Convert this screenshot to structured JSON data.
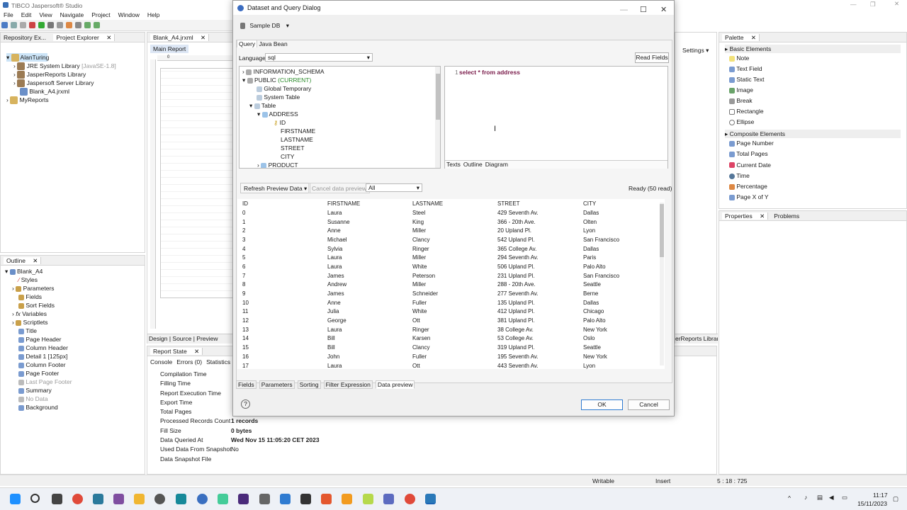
{
  "app": {
    "title": "TIBCO Jaspersoft® Studio",
    "menu": [
      "File",
      "Edit",
      "View",
      "Navigate",
      "Project",
      "Window",
      "Help"
    ]
  },
  "left": {
    "tabs": [
      "Repository Ex...",
      "Project Explorer"
    ],
    "tree": [
      {
        "label": "AlanTuring",
        "note": ""
      },
      {
        "label": "JRE System Library",
        "note": "[JavaSE-1.8]"
      },
      {
        "label": "JasperReports Library",
        "note": ""
      },
      {
        "label": "Jaspersoft Server Library",
        "note": ""
      },
      {
        "label": "Blank_A4.jrxml",
        "note": ""
      },
      {
        "label": "MyReports",
        "note": ""
      }
    ]
  },
  "editor": {
    "tab": "Blank_A4.jrxml",
    "subtab": "Main Report",
    "bottom_tabs": [
      "Design",
      "Source",
      "Preview"
    ],
    "ruler": "0"
  },
  "outline": {
    "tab": "Outline",
    "items": [
      "Blank_A4",
      "Styles",
      "Parameters",
      "Fields",
      "Sort Fields",
      "Variables",
      "Scriptlets",
      "Title",
      "Page Header",
      "Column Header",
      "Detail 1 [125px]",
      "Column Footer",
      "Page Footer",
      "Last Page Footer",
      "Summary",
      "No Data",
      "Background"
    ]
  },
  "report_state": {
    "tab": "Report State",
    "subtabs": [
      "Console",
      "Errors (0)",
      "Statistics"
    ],
    "rows": [
      {
        "label": "Compilation Time",
        "value": ""
      },
      {
        "label": "Filling Time",
        "value": ""
      },
      {
        "label": "Report Execution Time",
        "value": ""
      },
      {
        "label": "Export Time",
        "value": ""
      },
      {
        "label": "Total Pages",
        "value": ""
      },
      {
        "label": "Processed Records Count",
        "value": "1 records"
      },
      {
        "label": "Fill Size",
        "value": "0 bytes"
      },
      {
        "label": "Data Queried At",
        "value": "Wed Nov 15 11:05:20 CET 2023"
      },
      {
        "label": "Used Data From Snapshot",
        "value": "No"
      },
      {
        "label": "Data Snapshot File",
        "value": ""
      }
    ]
  },
  "palette": {
    "tab": "Palette",
    "basic_header": "Basic Elements",
    "basic": [
      "Note",
      "Text Field",
      "Static Text",
      "Image",
      "Break",
      "Rectangle",
      "Ellipse"
    ],
    "composite_header": "Composite Elements",
    "composite": [
      "Page Number",
      "Total Pages",
      "Current Date",
      "Time",
      "Percentage",
      "Page X of Y"
    ],
    "settings": "Settings",
    "lib": "erReports Library"
  },
  "props": {
    "tabs": [
      "Properties",
      "Problems"
    ]
  },
  "dialog": {
    "title": "Dataset and Query Dialog",
    "datasource": "Sample DB",
    "tabs": [
      "Query",
      "Java Bean"
    ],
    "language_label": "Language",
    "language": "sql",
    "read_fields": "Read Fields",
    "schema_tree": [
      {
        "label": "INFORMATION_SCHEMA",
        "indent": 0
      },
      {
        "label": "PUBLIC",
        "extra": "(CURRENT)",
        "indent": 0
      },
      {
        "label": "Global Temporary",
        "indent": 1
      },
      {
        "label": "System Table",
        "indent": 1
      },
      {
        "label": "Table",
        "indent": 1
      },
      {
        "label": "ADDRESS",
        "indent": 2
      },
      {
        "label": "ID",
        "indent": 3
      },
      {
        "label": "FIRSTNAME",
        "indent": 3
      },
      {
        "label": "LASTNAME",
        "indent": 3
      },
      {
        "label": "STREET",
        "indent": 3
      },
      {
        "label": "CITY",
        "indent": 3
      },
      {
        "label": "PRODUCT",
        "indent": 2
      }
    ],
    "query_line": "1",
    "query_text": "select * from address",
    "query_tabs": [
      "Texts",
      "Outline",
      "Diagram"
    ],
    "refresh": "Refresh Preview Data",
    "cancel_data": "Cancel data preview",
    "filter": "All",
    "ready": "Ready (50 read)",
    "columns": [
      "ID",
      "FIRSTNAME",
      "LASTNAME",
      "STREET",
      "CITY"
    ],
    "rows": [
      [
        "0",
        "Laura",
        "Steel",
        "429 Seventh Av.",
        "Dallas"
      ],
      [
        "1",
        "Susanne",
        "King",
        "366 - 20th Ave.",
        "Olten"
      ],
      [
        "2",
        "Anne",
        "Miller",
        "20 Upland Pl.",
        "Lyon"
      ],
      [
        "3",
        "Michael",
        "Clancy",
        "542 Upland Pl.",
        "San Francisco"
      ],
      [
        "4",
        "Sylvia",
        "Ringer",
        "365 College Av.",
        "Dallas"
      ],
      [
        "5",
        "Laura",
        "Miller",
        "294 Seventh Av.",
        "Paris"
      ],
      [
        "6",
        "Laura",
        "White",
        "506 Upland Pl.",
        "Palo Alto"
      ],
      [
        "7",
        "James",
        "Peterson",
        "231 Upland Pl.",
        "San Francisco"
      ],
      [
        "8",
        "Andrew",
        "Miller",
        "288 - 20th Ave.",
        "Seattle"
      ],
      [
        "9",
        "James",
        "Schneider",
        "277 Seventh Av.",
        "Berne"
      ],
      [
        "10",
        "Anne",
        "Fuller",
        "135 Upland Pl.",
        "Dallas"
      ],
      [
        "11",
        "Julia",
        "White",
        "412 Upland Pl.",
        "Chicago"
      ],
      [
        "12",
        "George",
        "Ott",
        "381 Upland Pl.",
        "Palo Alto"
      ],
      [
        "13",
        "Laura",
        "Ringer",
        "38 College Av.",
        "New York"
      ],
      [
        "14",
        "Bill",
        "Karsen",
        "53 College Av.",
        "Oslo"
      ],
      [
        "15",
        "Bill",
        "Clancy",
        "319 Upland Pl.",
        "Seattle"
      ],
      [
        "16",
        "John",
        "Fuller",
        "195 Seventh Av.",
        "New York"
      ],
      [
        "17",
        "Laura",
        "Ott",
        "443 Seventh Av.",
        "Lyon"
      ]
    ],
    "bottom_tabs": [
      "Fields",
      "Parameters",
      "Sorting",
      "Filter Expression",
      "Data preview"
    ],
    "ok": "OK",
    "cancel": "Cancel"
  },
  "statusbar": {
    "writable": "Writable",
    "insert": "Insert",
    "position": "5 : 18 : 725"
  },
  "clock": {
    "time": "11:17",
    "date": "15/11/2023"
  }
}
